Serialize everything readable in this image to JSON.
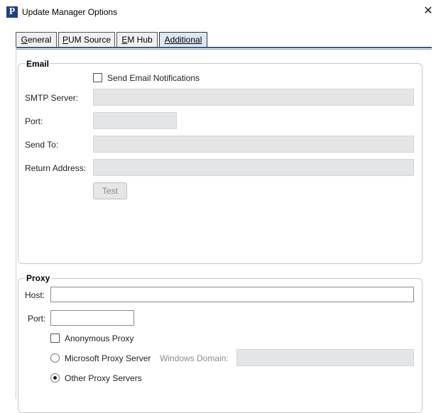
{
  "window": {
    "title": "Update Manager Options",
    "icon_letter": "P",
    "close_glyph": "✕"
  },
  "tabs": [
    {
      "label": "General",
      "mnemonic": "G",
      "rest": "eneral",
      "active": false
    },
    {
      "label": "PUM Source",
      "mnemonic": "P",
      "rest": "UM Source",
      "active": false
    },
    {
      "label": "EM Hub",
      "mnemonic": "E",
      "rest": "M Hub",
      "active": false
    },
    {
      "label": "Additional",
      "mnemonic": "A",
      "rest": "dditional",
      "active": true
    }
  ],
  "email": {
    "legend": "Email",
    "send_notifications_label": "Send Email Notifications",
    "send_notifications_checked": false,
    "smtp_label": "SMTP Server:",
    "smtp_value": "",
    "port_label": "Port:",
    "port_value": "",
    "send_to_label": "Send To:",
    "send_to_value": "",
    "return_label": "Return Address:",
    "return_value": "",
    "test_button": "Test"
  },
  "proxy": {
    "legend": "Proxy",
    "host_label": "Host:",
    "host_value": "",
    "port_label": "Port:",
    "port_value": "",
    "anonymous_label": "Anonymous Proxy",
    "anonymous_checked": false,
    "microsoft_label": "Microsoft Proxy Server",
    "windows_domain_label": "Windows Domain:",
    "windows_domain_value": "",
    "other_label": "Other Proxy Servers",
    "selected": "other"
  },
  "colors": {
    "active_tab_bg": "#dde8f5",
    "tab_rule": "#3a5a84",
    "disabled_field": "#e4e5e7",
    "app_icon": "#1c3f85"
  },
  "icons": {
    "app": "peoplesoft-p-icon",
    "close": "close-icon"
  }
}
